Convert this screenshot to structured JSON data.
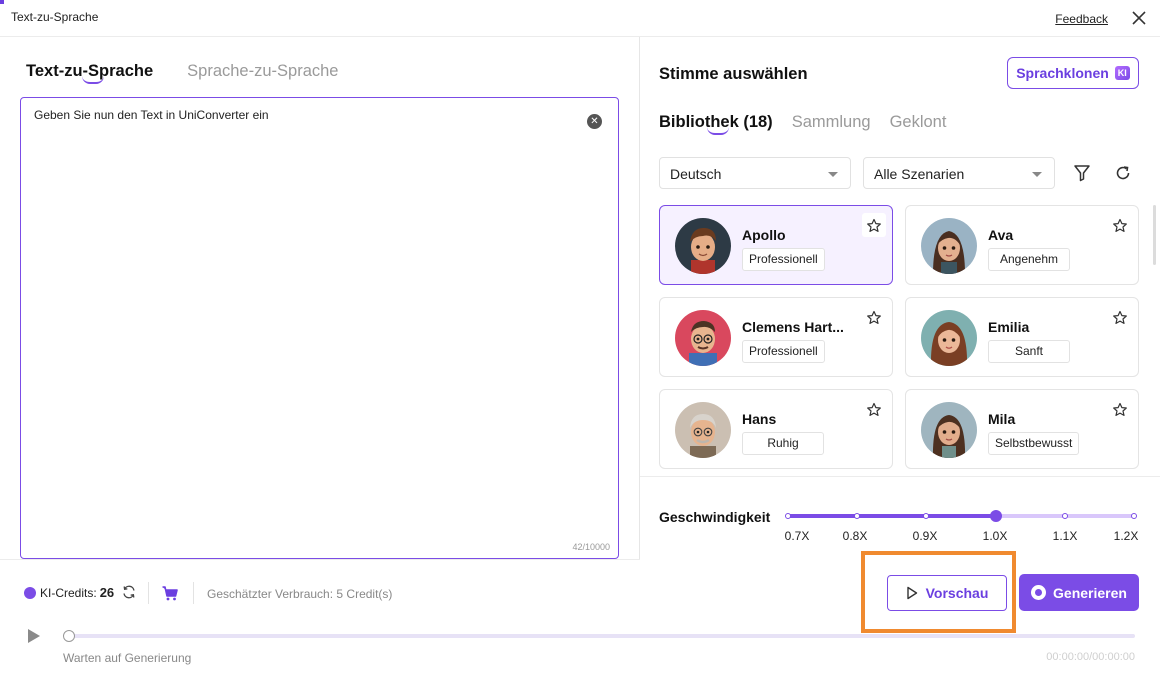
{
  "window": {
    "title": "Text-zu-Sprache",
    "feedback": "Feedback"
  },
  "left": {
    "tabs": [
      {
        "label": "Text-zu-Sprache",
        "active": true
      },
      {
        "label": "Sprache-zu-Sprache",
        "active": false
      }
    ],
    "text": "Geben Sie nun den Text in UniConverter ein",
    "counter": "42/10000"
  },
  "right": {
    "title": "Stimme auswählen",
    "clone_button": "Sprachklonen",
    "clone_badge": "KI",
    "tabs": [
      {
        "label": "Bibliothek (18)",
        "active": true
      },
      {
        "label": "Sammlung",
        "active": false
      },
      {
        "label": "Geklont",
        "active": false
      }
    ],
    "language": "Deutsch",
    "scenario": "Alle Szenarien",
    "voices": [
      {
        "name": "Apollo",
        "tag": "Professionell",
        "selected": true,
        "gender": "male"
      },
      {
        "name": "Ava",
        "tag": "Angenehm",
        "selected": false,
        "gender": "female"
      },
      {
        "name": "Clemens Hart...",
        "tag": "Professionell",
        "selected": false,
        "gender": "male"
      },
      {
        "name": "Emilia",
        "tag": "Sanft",
        "selected": false,
        "gender": "female"
      },
      {
        "name": "Hans",
        "tag": "Ruhig",
        "selected": false,
        "gender": "male"
      },
      {
        "name": "Mila",
        "tag": "Selbstbewusst",
        "selected": false,
        "gender": "female"
      }
    ],
    "speed": {
      "label": "Geschwindigkeit",
      "options": [
        "0.7X",
        "0.8X",
        "0.9X",
        "1.0X",
        "1.1X",
        "1.2X"
      ],
      "selected_index": 3
    }
  },
  "footer": {
    "credits_label": "KI-Credits:",
    "credits_value": "26",
    "estimate": "Geschätzter Verbrauch: 5 Credit(s)",
    "preview_button": "Vorschau",
    "generate_button": "Generieren",
    "status": "Warten auf Generierung",
    "time": "00:00:00/00:00:00",
    "progress": 0
  },
  "colors": {
    "accent": "#7b4ce6",
    "highlight": "#f08a2f"
  },
  "icons": [
    "close-icon",
    "clear-icon",
    "filter-icon",
    "refresh-icon",
    "star-icon",
    "play-icon",
    "cart-icon",
    "gem-icon"
  ]
}
